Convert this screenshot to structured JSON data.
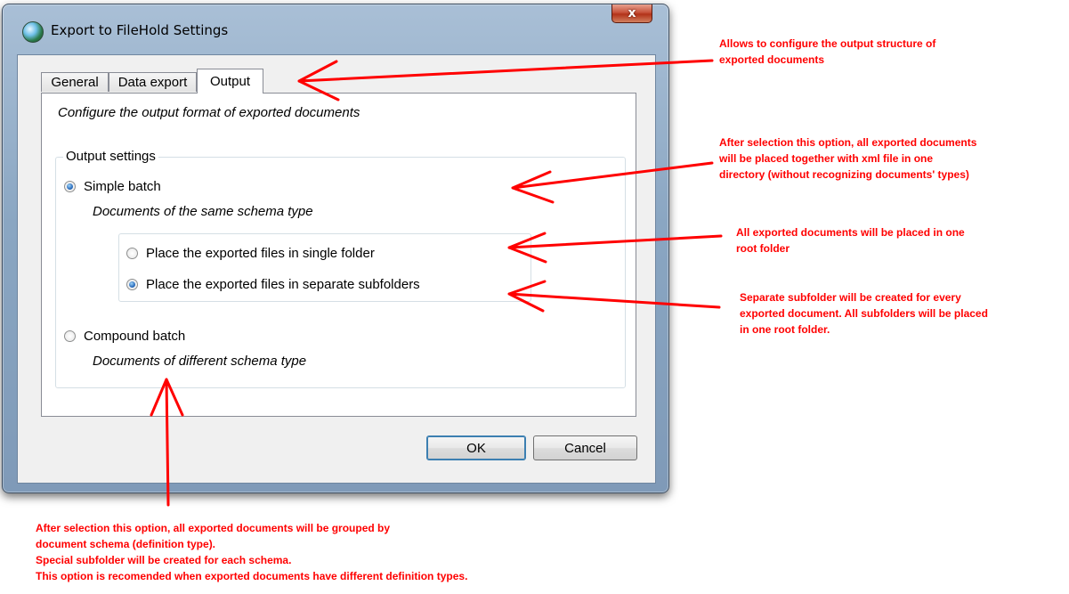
{
  "window": {
    "title": "Export to FileHold Settings",
    "close_symbol": "x"
  },
  "tabs": [
    {
      "label": "General",
      "active": false
    },
    {
      "label": "Data export",
      "active": false
    },
    {
      "label": "Output",
      "active": true
    }
  ],
  "output_tab": {
    "description": "Configure the output format of exported documents",
    "group_title": "Output settings",
    "simple_batch": {
      "label": "Simple batch",
      "checked": true,
      "description": "Documents of the same schema type"
    },
    "single_folder": {
      "label": "Place the exported files in single folder",
      "checked": false
    },
    "separate_subfolders": {
      "label": "Place the exported files in separate subfolders",
      "checked": true
    },
    "compound_batch": {
      "label": "Compound batch",
      "checked": false,
      "description": "Documents of different schema type"
    }
  },
  "buttons": {
    "ok": "OK",
    "cancel": "Cancel"
  },
  "annotations": {
    "output_tab_note": "Allows to configure the output structure of\nexported documents",
    "simple_batch_note": "After selection this option, all exported documents\nwill be placed together with xml file in one\ndirectory (without recognizing documents' types)",
    "single_folder_note": "All exported documents will be placed in one\nroot folder",
    "subfolders_note": "Separate subfolder will be created for every\nexported document. All subfolders will be placed\nin one root folder.",
    "compound_batch_note": "After selection this option, all exported documents will be grouped by\ndocument schema (definition type).\nSpecial subfolder will be created for each schema.\nThis option is recomended when exported documents have different definition types.",
    "color": "#ff0000"
  }
}
